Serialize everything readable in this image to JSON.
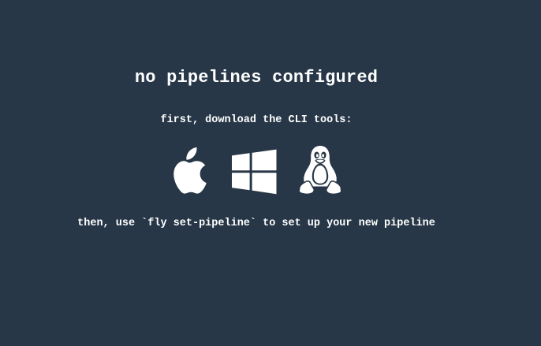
{
  "empty_state": {
    "title": "no pipelines configured",
    "download_prompt": "first, download the CLI tools:",
    "instructions": "then, use `fly set-pipeline` to set up your new pipeline"
  },
  "cli_downloads": [
    {
      "platform": "osx",
      "icon": "apple-icon"
    },
    {
      "platform": "windows",
      "icon": "windows-icon"
    },
    {
      "platform": "linux",
      "icon": "linux-tux-icon"
    }
  ],
  "colors": {
    "background": "#273747",
    "text": "#ffffff"
  }
}
